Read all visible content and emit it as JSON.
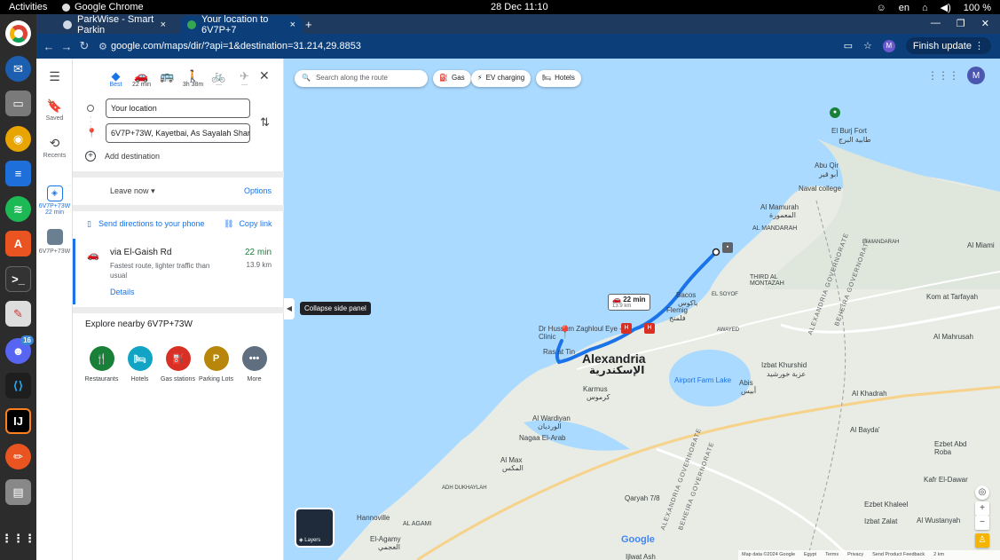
{
  "system_bar": {
    "activities": "Activities",
    "app_name": "Google Chrome",
    "clock": "28 Dec  11:10",
    "lang": "en",
    "battery": "100 %"
  },
  "dock": {
    "discord_badge": "16",
    "items": [
      "chrome",
      "thunderbird",
      "files",
      "rhythmbox",
      "writer",
      "spotify",
      "software",
      "terminal",
      "text-editor",
      "discord",
      "vscode",
      "jetbrains",
      "inkscape",
      "notes",
      "apps"
    ]
  },
  "browser": {
    "tabs": [
      {
        "title": "ParkWise - Smart Parkin",
        "close": "×"
      },
      {
        "title": "Your location to 6V7P+7",
        "close": "×"
      }
    ],
    "new_tab": "+",
    "url": "google.com/maps/dir/?api=1&destination=31.214,29.8853",
    "profile": "M",
    "finish_update": "Finish update"
  },
  "rail": {
    "saved": "Saved",
    "recents": "Recents",
    "recent_route_label": "6V7P+73W",
    "recent_route_time": "22 min",
    "recent_place_label": "6V7P+73W"
  },
  "directions": {
    "modes": [
      {
        "name": "best",
        "label": "Best"
      },
      {
        "name": "driving",
        "label": "22 min"
      },
      {
        "name": "transit",
        "label": ""
      },
      {
        "name": "walking",
        "label": "3h 38m"
      },
      {
        "name": "cycling",
        "label": "—"
      },
      {
        "name": "flight",
        "label": "—"
      }
    ],
    "origin": "Your location",
    "destination": "6V7P+73W, Kayetbai, As Sayalah Sharq, A",
    "add_destination": "Add destination",
    "leave_now": "Leave now",
    "options": "Options",
    "send_to_phone": "Send directions to your phone",
    "copy_link": "Copy link",
    "route": {
      "via": "via El-Gaish Rd",
      "desc": "Fastest route, lighter traffic than usual",
      "time": "22 min",
      "distance": "13.9 km",
      "details": "Details"
    },
    "explore_title": "Explore nearby 6V7P+73W",
    "nearby": [
      {
        "label": "Restaurants",
        "color": "#188038",
        "glyph": "🍴"
      },
      {
        "label": "Hotels",
        "color": "#12a4c4",
        "glyph": "🛏"
      },
      {
        "label": "Gas stations",
        "color": "#d93025",
        "glyph": "⛽"
      },
      {
        "label": "Parking Lots",
        "color": "#b8860b",
        "glyph": "P"
      },
      {
        "label": "More",
        "color": "#5f6f7f",
        "glyph": "•••"
      }
    ]
  },
  "map": {
    "search_placeholder": "Search along the route",
    "chips": [
      "Gas",
      "EV charging",
      "Hotels"
    ],
    "avatar": "M",
    "collapse_tooltip": "Collapse side panel",
    "route_box_time": "22 min",
    "route_box_dist": "13.9 km",
    "layers": "Layers",
    "google": "Google",
    "labels": {
      "alexandria_en": "Alexandria",
      "alexandria_ar": "الإسكندرية",
      "abu_qir": "Abu Qir",
      "abu_qir_ar": "أبو قير",
      "burj": "El Burj Fort",
      "burj_ar": "طابية البرج",
      "naval": "Naval college",
      "mamurah": "Al Mamurah",
      "mamurah_ar": "المعمورة",
      "mandarah": "AL MANDARAH",
      "mandarah2": "El MANDARAH",
      "miami": "Al Miami",
      "bacos": "Bacos",
      "bacos_ar": "باكوس",
      "flemig": "Flemig",
      "flemig_ar": "فلمنج",
      "soyof": "EL SOYOF",
      "third": "THIRD AL MONTAZAH",
      "awayed": "AWAYED",
      "kom": "Kom at Tarfayah",
      "mahrusah": "Al Mahrusah",
      "abis": "Abis",
      "abis_ar": "أبيس",
      "izbat": "Izbat Khurshid",
      "izbat_ar": "عزبة خورشيد",
      "airport": "Airport Farm Lake",
      "karmus": "Karmus",
      "karmus_ar": "كرموس",
      "wardiyan": "Al Wardiyan",
      "wardiyan_ar": "الورديان",
      "nagaa": "Nagaa El-Arab",
      "almax": "Al Max",
      "almax_ar": "المكس",
      "dukhaylah": "ADH DUKHAYLAH",
      "hannoville": "Hannoville",
      "agami": "AL AGAMI",
      "elagamy": "El-Agamy",
      "elagamy_ar": "العجمي",
      "qaryah": "Qaryah 7/8",
      "khadrah": "Al Khadrah",
      "bayda": "Al Bayda'",
      "ezbet": "Ezbet Abd Roba",
      "kafr": "Kafr El-Dawar",
      "khaleel": "Ezbet Khaleel",
      "zalat": "Izbat Zalat",
      "wustanyah": "Al Wustanyah",
      "hussam": "Dr Hussam Zaghloul Eye - Clinic",
      "ras": "Ras at Tin",
      "ijlwat": "Ijlwat Ash",
      "gov1": "ALEXANDRIA GOVERNORATE",
      "gov2": "BEHEIRA GOVERNORATE"
    },
    "footer": [
      "Map data ©2024 Google",
      "Egypt",
      "Terms",
      "Privacy",
      "Send Product Feedback",
      "2 km"
    ],
    "accent": "#1a73e8"
  }
}
